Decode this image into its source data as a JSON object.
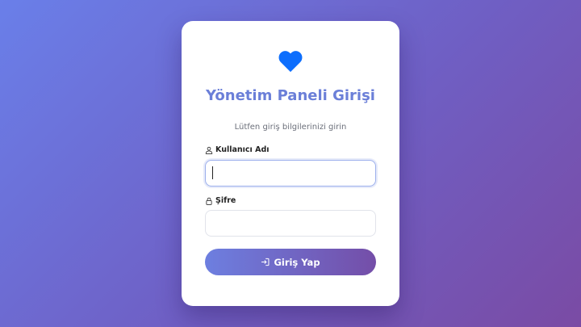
{
  "login": {
    "title": "Yönetim Paneli Girişi",
    "subtitle": "Lütfen giriş bilgilerinizi girin",
    "username_label": "Kullanıcı Adı",
    "username_value": "",
    "password_label": "Şifre",
    "password_value": "",
    "submit_label": "Giriş Yap"
  },
  "icons": {
    "logo": "heart-icon",
    "username": "user-icon",
    "password": "lock-icon",
    "submit": "sign-in-icon"
  },
  "colors": {
    "accent": "#0d6efd",
    "title": "#6b7fd8",
    "background_start": "#6a7fe9",
    "background_end": "#7a4ba4"
  }
}
